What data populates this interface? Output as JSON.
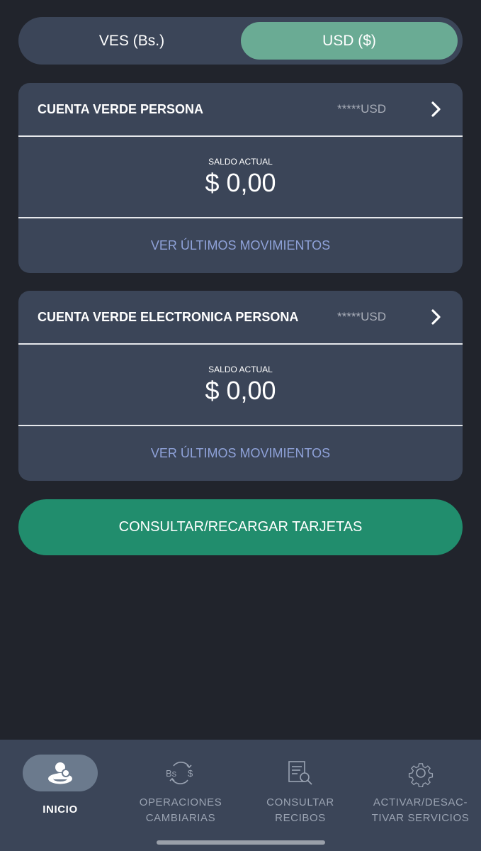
{
  "currency_toggle": {
    "options": [
      "VES (Bs.)",
      "USD ($)"
    ],
    "selected": "USD ($)"
  },
  "accounts": [
    {
      "name": "CUENTA VERDE PERSONA",
      "masked_number": "*****USD",
      "balance_label": "SALDO ACTUAL",
      "balance": "$ 0,00",
      "movements_link": "VER ÚLTIMOS MOVIMIENTOS"
    },
    {
      "name": "CUENTA VERDE ELECTRONICA PERSONA",
      "masked_number": "*****USD",
      "balance_label": "SALDO ACTUAL",
      "balance": "$ 0,00",
      "movements_link": "VER ÚLTIMOS MOVIMIENTOS"
    }
  ],
  "cards_button": "CONSULTAR/RECARGAR TARJETAS",
  "bottom_nav": {
    "items": [
      {
        "label": "INICIO",
        "icon": "home-user-icon",
        "active": true
      },
      {
        "label": "OPERACIONES\nCAMBIARIAS",
        "icon": "currency-exchange-icon",
        "active": false
      },
      {
        "label": "CONSULTAR\nRECIBOS",
        "icon": "receipt-search-icon",
        "active": false
      },
      {
        "label": "ACTIVAR/DESAC-\nTIVAR SERVICIOS",
        "icon": "gear-icon",
        "active": false
      }
    ]
  },
  "colors": {
    "background": "#21242c",
    "card": "#3b4558",
    "toggle_active": "#6aab94",
    "primary_button": "#218d6d",
    "link": "#8fa2d9"
  }
}
